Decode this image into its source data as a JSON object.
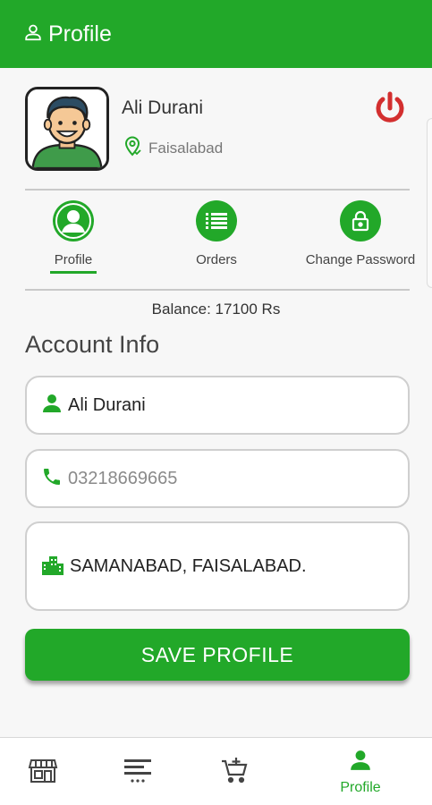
{
  "app_bar": {
    "title": "Profile",
    "icon": "user-outline-icon"
  },
  "user": {
    "name": "Ali Durani",
    "location": "Faisalabad"
  },
  "tabs": [
    {
      "label": "Profile",
      "icon": "profile-icon",
      "active": true
    },
    {
      "label": "Orders",
      "icon": "list-icon",
      "active": false
    },
    {
      "label": "Change Password",
      "icon": "lock-icon",
      "active": false
    }
  ],
  "balance": "Balance: 17100 Rs",
  "section_title": "Account Info",
  "form": {
    "name_value": "Ali Durani",
    "phone_placeholder": "03218669665",
    "address_value": "SAMANABAD, FAISALABAD."
  },
  "save_button": "SAVE PROFILE",
  "bottom_nav": [
    {
      "label": "",
      "icon": "store-icon"
    },
    {
      "label": "",
      "icon": "menu-icon"
    },
    {
      "label": "",
      "icon": "cart-add-icon"
    },
    {
      "label": "Profile",
      "icon": "person-icon",
      "active": true
    }
  ],
  "colors": {
    "primary": "#22a829",
    "power": "#d32f2f"
  }
}
